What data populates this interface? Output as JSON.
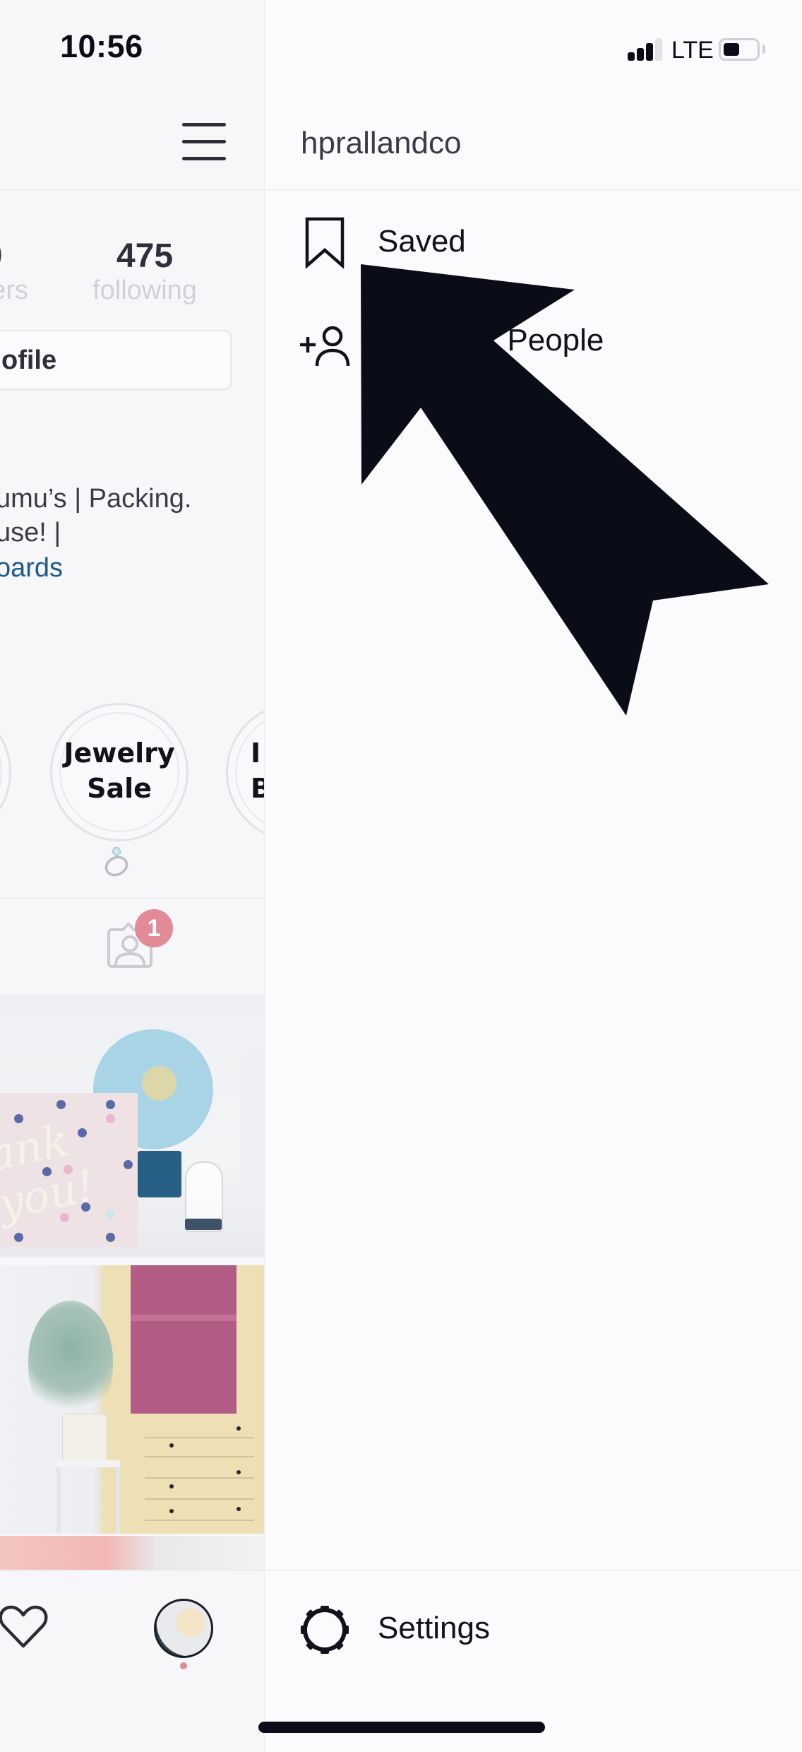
{
  "status_bar": {
    "time": "10:56",
    "network": "LTE",
    "signal_bars_active": 3,
    "signal_bars_total": 4,
    "battery_level": 0.5
  },
  "profile": {
    "menu_icon": "hamburger-menu-icon",
    "stats": {
      "followers_count_partial": "9",
      "followers_label_partial": "ers",
      "following_count": "475",
      "following_label": "following"
    },
    "edit_profile_partial": "ofile",
    "bio_lines": [
      "umu’s | Packing.",
      "use! |",
      "oards"
    ],
    "bio_link_color": "#1f5a8c",
    "highlights": [
      {
        "title": "",
        "partial": true
      },
      {
        "title_line1": "Jewelry",
        "title_line2": "Sale",
        "label_emoji": "💍"
      },
      {
        "title_line1": "I",
        "title_line2": "B",
        "partial": true
      }
    ],
    "tagged_tab": {
      "icon": "tagged-photos-icon",
      "badge_count": "1",
      "badge_color": "#e28a95"
    },
    "photos": [
      {
        "description": "Thank you card with globe"
      },
      {
        "description": "Yellow hutch with pink shelves and fiddle leaf fig"
      },
      {
        "description": "Pink feathers"
      }
    ],
    "tab_bar": {
      "activity_icon": "heart-icon",
      "profile_icon": "avatar",
      "notification_dot_color": "#e08b94"
    }
  },
  "drawer": {
    "username": "hprallandco",
    "menu_items": [
      {
        "icon": "bookmark-icon",
        "label": "Saved"
      },
      {
        "icon": "add-person-icon",
        "label": "Discover People",
        "visible_label": "r People"
      }
    ],
    "footer_item": {
      "icon": "gear-icon",
      "label": "Settings"
    }
  },
  "annotation": {
    "type": "arrow",
    "color": "#0a0d18",
    "points_to": "Saved"
  }
}
